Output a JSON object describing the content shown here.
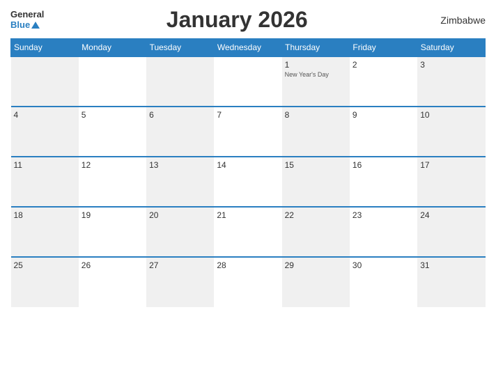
{
  "header": {
    "logo_general": "General",
    "logo_blue": "Blue",
    "title": "January 2026",
    "country": "Zimbabwe"
  },
  "weekdays": [
    "Sunday",
    "Monday",
    "Tuesday",
    "Wednesday",
    "Thursday",
    "Friday",
    "Saturday"
  ],
  "weeks": [
    [
      {
        "day": "",
        "holiday": ""
      },
      {
        "day": "",
        "holiday": ""
      },
      {
        "day": "",
        "holiday": ""
      },
      {
        "day": "",
        "holiday": ""
      },
      {
        "day": "1",
        "holiday": "New Year's Day"
      },
      {
        "day": "2",
        "holiday": ""
      },
      {
        "day": "3",
        "holiday": ""
      }
    ],
    [
      {
        "day": "4",
        "holiday": ""
      },
      {
        "day": "5",
        "holiday": ""
      },
      {
        "day": "6",
        "holiday": ""
      },
      {
        "day": "7",
        "holiday": ""
      },
      {
        "day": "8",
        "holiday": ""
      },
      {
        "day": "9",
        "holiday": ""
      },
      {
        "day": "10",
        "holiday": ""
      }
    ],
    [
      {
        "day": "11",
        "holiday": ""
      },
      {
        "day": "12",
        "holiday": ""
      },
      {
        "day": "13",
        "holiday": ""
      },
      {
        "day": "14",
        "holiday": ""
      },
      {
        "day": "15",
        "holiday": ""
      },
      {
        "day": "16",
        "holiday": ""
      },
      {
        "day": "17",
        "holiday": ""
      }
    ],
    [
      {
        "day": "18",
        "holiday": ""
      },
      {
        "day": "19",
        "holiday": ""
      },
      {
        "day": "20",
        "holiday": ""
      },
      {
        "day": "21",
        "holiday": ""
      },
      {
        "day": "22",
        "holiday": ""
      },
      {
        "day": "23",
        "holiday": ""
      },
      {
        "day": "24",
        "holiday": ""
      }
    ],
    [
      {
        "day": "25",
        "holiday": ""
      },
      {
        "day": "26",
        "holiday": ""
      },
      {
        "day": "27",
        "holiday": ""
      },
      {
        "day": "28",
        "holiday": ""
      },
      {
        "day": "29",
        "holiday": ""
      },
      {
        "day": "30",
        "holiday": ""
      },
      {
        "day": "31",
        "holiday": ""
      }
    ]
  ]
}
